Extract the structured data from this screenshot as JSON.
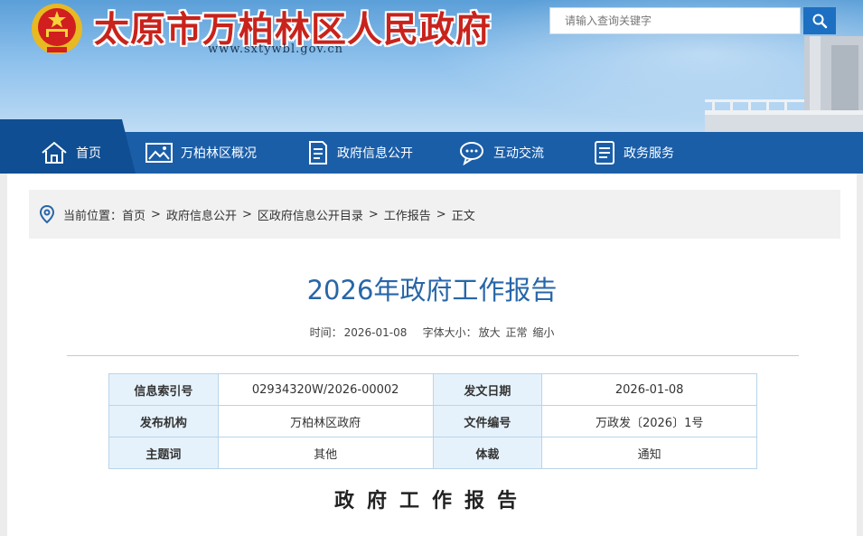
{
  "header": {
    "site_title": "太原市万柏林区人民政府",
    "site_url": "www.sxtywbl.gov.cn",
    "search_placeholder": "请输入查询关键字",
    "colors": {
      "title_red": "#c8231c",
      "nav_blue": "#1b5ea8",
      "accent_blue": "#2766a8"
    }
  },
  "nav": {
    "items": [
      {
        "label": "首页",
        "icon": "home-icon"
      },
      {
        "label": "万柏林区概况",
        "icon": "image-icon"
      },
      {
        "label": "政府信息公开",
        "icon": "document-icon"
      },
      {
        "label": "互动交流",
        "icon": "chat-icon"
      },
      {
        "label": "政务服务",
        "icon": "list-icon"
      }
    ]
  },
  "breadcrumb": {
    "prefix": "当前位置：",
    "items": [
      "首页",
      "政府信息公开",
      "区政府信息公开目录",
      "工作报告",
      "正文"
    ],
    "separator": ">"
  },
  "article": {
    "title": "2026年政府工作报告",
    "date_label": "时间：",
    "date": "2026-01-08",
    "font_size_label": "字体大小：",
    "font_options": [
      "放大",
      "正常",
      "缩小"
    ],
    "body_heading": "政府工作报告"
  },
  "info_table": [
    [
      "信息索引号",
      "02934320W/2026-00002",
      "发文日期",
      "2026-01-08"
    ],
    [
      "发布机构",
      "万柏林区政府",
      "文件编号",
      "万政发〔2026〕1号"
    ],
    [
      "主题词",
      "其他",
      "体裁",
      "通知"
    ]
  ]
}
